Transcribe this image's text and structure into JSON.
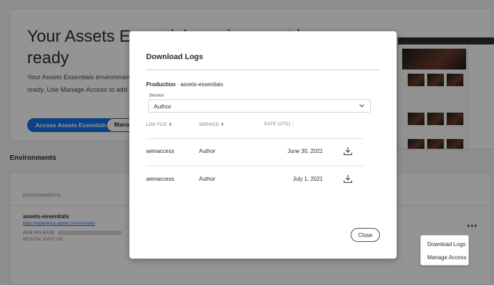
{
  "hero": {
    "title": "Your Assets Essentials environment is ready",
    "subtitle": "Your Assets Essentials environment is ready. Use Manage Access to add users,",
    "primary_button": "Access Assets Essentials",
    "secondary_button": "Manage Access"
  },
  "environments": {
    "heading": "Environments",
    "column_header": "ENVIRONMENTS",
    "name": "assets-essentials",
    "url": "https://experience.adobe.com/#/Assets",
    "release_label": "AEM RELEASE",
    "region": "REGION: EAST US",
    "more_icon": "more-horizontal-icon"
  },
  "context_menu": {
    "items": [
      "Download Logs",
      "Manage Access"
    ]
  },
  "modal": {
    "title": "Download Logs",
    "environment_prefix": "Production",
    "environment_separator": " · ",
    "environment_name": "assets-essentials",
    "service_label": "Service",
    "service_value": "Author",
    "columns": {
      "log_file": "LOG FILE",
      "service": "SERVICE",
      "date": "DATE (UTC)"
    },
    "rows": [
      {
        "log_file": "aemaccess",
        "service": "Author",
        "date": "June 30, 2021"
      },
      {
        "log_file": "aemaccess",
        "service": "Author",
        "date": "July 1, 2021"
      }
    ],
    "close_label": "Close"
  }
}
